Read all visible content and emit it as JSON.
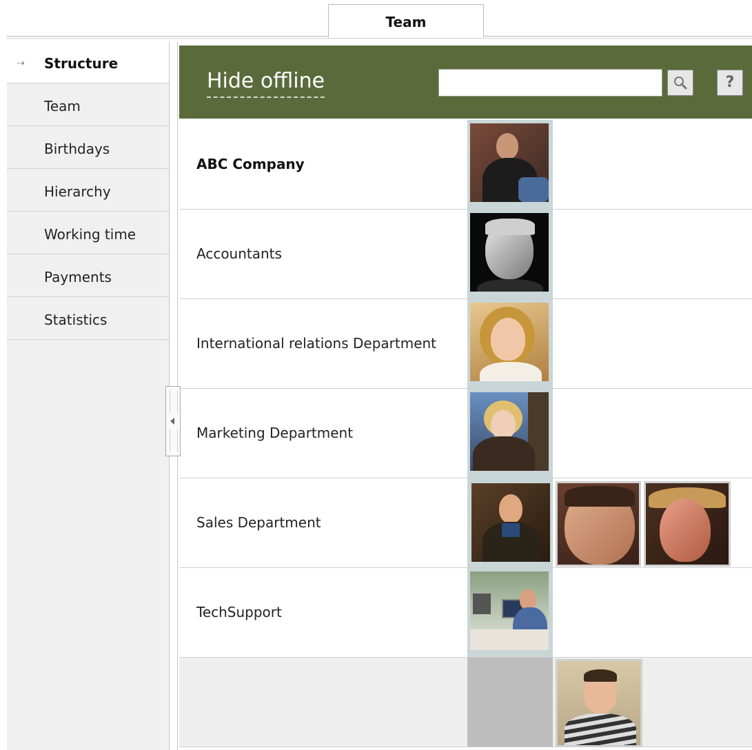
{
  "tabs": [
    {
      "label": "Team"
    }
  ],
  "sidebar": {
    "items": [
      {
        "label": "Structure"
      },
      {
        "label": "Team"
      },
      {
        "label": "Birthdays"
      },
      {
        "label": "Hierarchy"
      },
      {
        "label": "Working time"
      },
      {
        "label": "Payments"
      },
      {
        "label": "Statistics"
      }
    ]
  },
  "header": {
    "hide_offline": "Hide offline",
    "search_value": "",
    "help_label": "?"
  },
  "rows": [
    {
      "label": "ABC Company"
    },
    {
      "label": "Accountants"
    },
    {
      "label": "International relations Department"
    },
    {
      "label": "Marketing Department"
    },
    {
      "label": "Sales Department"
    },
    {
      "label": "TechSupport"
    },
    {
      "label": ""
    }
  ],
  "colors": {
    "header_bg": "#5b6a3b",
    "sidebar_bg": "#f0f0f0",
    "photo_frame": "#c9d6d8"
  }
}
